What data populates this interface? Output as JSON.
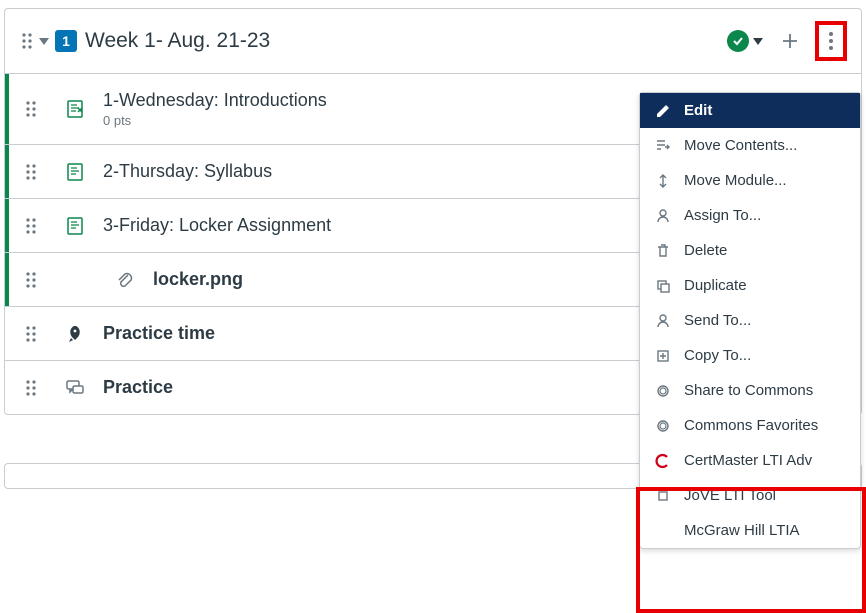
{
  "module": {
    "badge": "1",
    "title": "Week 1- Aug. 21-23",
    "items": [
      {
        "title": "1-Wednesday: Introductions",
        "sub": "0 pts",
        "type": "page-green",
        "indent": false
      },
      {
        "title": "2-Thursday: Syllabus",
        "sub": "",
        "type": "page-green",
        "indent": false
      },
      {
        "title": "3-Friday: Locker Assignment",
        "sub": "",
        "type": "page-green",
        "indent": false
      },
      {
        "title": "locker.png",
        "sub": "",
        "type": "attachment",
        "indent": true
      },
      {
        "title": "Practice time",
        "sub": "",
        "type": "rocket",
        "indent": false
      },
      {
        "title": "Practice",
        "sub": "",
        "type": "discussion",
        "indent": false
      }
    ]
  },
  "menu": {
    "edit": "Edit",
    "move_contents": "Move Contents...",
    "move_module": "Move Module...",
    "assign_to": "Assign To...",
    "delete": "Delete",
    "duplicate": "Duplicate",
    "send_to": "Send To...",
    "copy_to": "Copy To...",
    "share_commons": "Share to Commons",
    "commons_fav": "Commons Favorites",
    "certmaster": "CertMaster LTI Adv",
    "jove": "JoVE LTI Tool",
    "mcgraw": "McGraw Hill LTIA"
  }
}
